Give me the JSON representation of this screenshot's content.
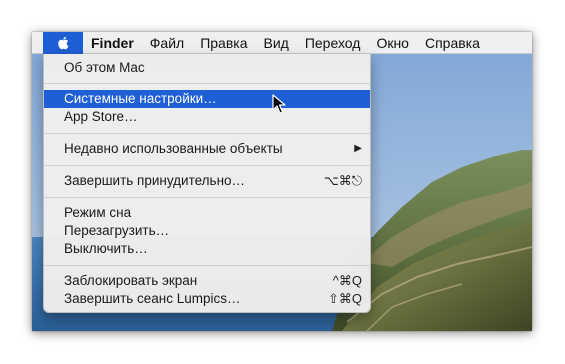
{
  "colors": {
    "highlight": "#1f5fd6",
    "menu_bg": "#eeeeee"
  },
  "menubar": {
    "apple_icon": "apple-logo-icon",
    "items": [
      "Finder",
      "Файл",
      "Правка",
      "Вид",
      "Переход",
      "Окно",
      "Справка"
    ]
  },
  "apple_menu": {
    "about": "Об этом Mac",
    "system_prefs": "Системные настройки…",
    "app_store": "App Store…",
    "recent": "Недавно использованные объекты",
    "recent_arrow": "▶",
    "force_quit": "Завершить принудительно…",
    "force_quit_shortcut": "⌥⌘⎋",
    "sleep": "Режим сна",
    "restart": "Перезагрузить…",
    "shutdown": "Выключить…",
    "lock": "Заблокировать экран",
    "lock_shortcut": "^⌘Q",
    "logout": "Завершить сеанс Lumpics…",
    "logout_shortcut": "⇧⌘Q"
  }
}
